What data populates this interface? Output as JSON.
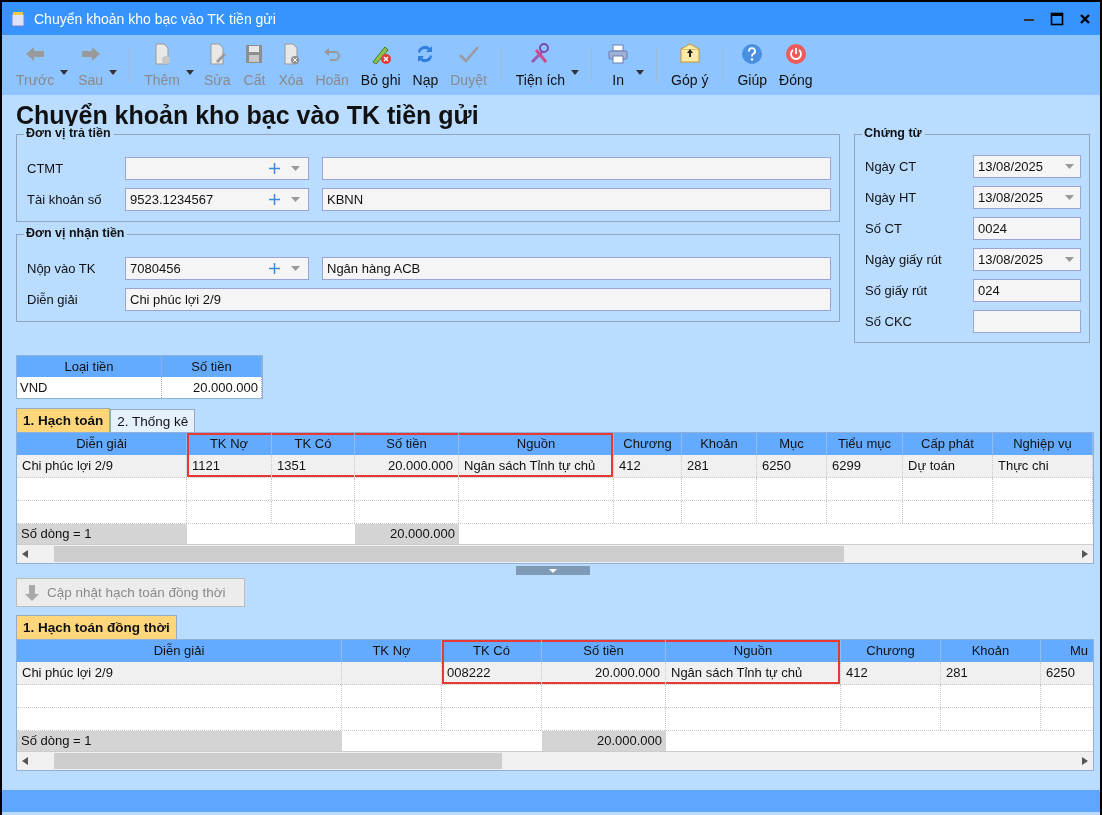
{
  "window": {
    "title": "Chuyển khoản kho bạc vào TK tiền gửi"
  },
  "toolbar": [
    {
      "items": [
        {
          "label": "Trước",
          "disabled": true,
          "kind": "split"
        },
        {
          "label": "Sau",
          "disabled": true,
          "kind": "split"
        }
      ]
    },
    {
      "items": [
        {
          "label": "Thêm",
          "disabled": true,
          "kind": "split"
        },
        {
          "label": "Sửa",
          "disabled": true,
          "kind": "plain"
        },
        {
          "label": "Cất",
          "disabled": true,
          "kind": "plain"
        },
        {
          "label": "Xóa",
          "disabled": true,
          "kind": "plain"
        },
        {
          "label": "Hoãn",
          "disabled": true,
          "kind": "plain"
        },
        {
          "label": "Bỏ ghi",
          "disabled": false,
          "kind": "plain"
        },
        {
          "label": "Nạp",
          "disabled": false,
          "kind": "plain"
        },
        {
          "label": "Duyệt",
          "disabled": true,
          "kind": "plain"
        }
      ]
    },
    {
      "items": [
        {
          "label": "Tiện ích",
          "disabled": false,
          "kind": "split"
        }
      ]
    },
    {
      "items": [
        {
          "label": "In",
          "disabled": false,
          "kind": "split"
        }
      ]
    },
    {
      "items": [
        {
          "label": "Góp ý",
          "disabled": false,
          "kind": "plain"
        }
      ]
    },
    {
      "items": [
        {
          "label": "Giúp",
          "disabled": false,
          "kind": "plain"
        },
        {
          "label": "Đóng",
          "disabled": false,
          "kind": "plain"
        }
      ]
    }
  ],
  "page_title": "Chuyển khoản kho bạc vào TK tiền gửi",
  "payer": {
    "title": "Đơn vị trả tiền",
    "fields": [
      {
        "kind": "combo",
        "label": "CTMT"
      },
      {
        "kind": "combo",
        "label": "Tài khoản số",
        "value": "9523.1234567",
        "detail": "KBNN"
      }
    ]
  },
  "payee": {
    "title": "Đơn vị nhận tiền",
    "fields": [
      {
        "kind": "combo",
        "label": "Nộp vào TK",
        "value": "7080456",
        "detail": "Ngân hàng ACB"
      },
      {
        "kind": "text",
        "label": "Diễn giải",
        "value": "Chi phúc lợi 2/9"
      }
    ]
  },
  "voucher": {
    "title": "Chứng từ",
    "fields": [
      {
        "kind": "date",
        "label": "Ngày CT",
        "value": "13/08/2025"
      },
      {
        "kind": "date",
        "label": "Ngày HT",
        "value": "13/08/2025"
      },
      {
        "kind": "text",
        "label": "Số CT",
        "value": "0024"
      },
      {
        "kind": "date",
        "label": "Ngày giấy rút",
        "value": "13/08/2025"
      },
      {
        "kind": "text",
        "label": "Số giấy rút",
        "value": "024"
      },
      {
        "kind": "text",
        "label": "Số CKC"
      }
    ]
  },
  "currency_table": {
    "columns": [
      "Loại tiền",
      "Số tiền"
    ],
    "rows": [
      [
        "VND",
        "20.000.000"
      ]
    ]
  },
  "grids": [
    {
      "tabs": [
        {
          "label": "1. Hạch toán",
          "selected": true
        },
        {
          "label": "2. Thống kê",
          "selected": false
        }
      ],
      "columns": [
        {
          "label": "Diễn giải",
          "kind": "text",
          "highlighted": false
        },
        {
          "label": "TK Nợ",
          "kind": "text",
          "highlighted": true
        },
        {
          "label": "TK Có",
          "kind": "text",
          "highlighted": true
        },
        {
          "label": "Số tiền",
          "kind": "amount",
          "highlighted": true
        },
        {
          "label": "Nguồn",
          "kind": "text",
          "highlighted": true
        },
        {
          "label": "Chương",
          "kind": "text",
          "highlighted": false
        },
        {
          "label": "Khoản",
          "kind": "text",
          "highlighted": false
        },
        {
          "label": "Mục",
          "kind": "text",
          "highlighted": false
        },
        {
          "label": "Tiểu mục",
          "kind": "text",
          "highlighted": false
        },
        {
          "label": "Cấp phát",
          "kind": "text",
          "highlighted": false
        },
        {
          "label": "Nghiệp vụ",
          "kind": "text",
          "highlighted": false
        }
      ],
      "rows": [
        {
          "selected": true,
          "cells": [
            "Chi phúc lợi 2/9",
            "1121",
            "1351",
            "20.000.000",
            "Ngân sách Tỉnh tự chủ",
            "412",
            "281",
            "6250",
            "6299",
            "Dự toán",
            "Thực chi"
          ]
        }
      ],
      "footer": {
        "count": "Số dòng = 1",
        "total": "20.000.000"
      }
    },
    {
      "tabs": [
        {
          "label": "1. Hạch toán đồng thời",
          "selected": true
        }
      ],
      "columns": [
        {
          "label": "Diễn giải",
          "kind": "text",
          "highlighted": false
        },
        {
          "label": "TK Nợ",
          "kind": "text",
          "highlighted": false
        },
        {
          "label": "TK Có",
          "kind": "text",
          "highlighted": true
        },
        {
          "label": "Số tiền",
          "kind": "amount",
          "highlighted": true
        },
        {
          "label": "Nguồn",
          "kind": "text",
          "highlighted": true
        },
        {
          "label": "Chương",
          "kind": "text",
          "highlighted": false
        },
        {
          "label": "Khoản",
          "kind": "text",
          "highlighted": false
        },
        {
          "label": "Mu",
          "kind": "text",
          "highlighted": false
        }
      ],
      "rows": [
        {
          "selected": true,
          "cells": [
            "Chi phúc lợi 2/9",
            "",
            "008222",
            "20.000.000",
            "Ngân sách Tỉnh tự chủ",
            "412",
            "281",
            "6250"
          ]
        }
      ],
      "footer": {
        "count": "Số dòng = 1",
        "total": "20.000.000"
      }
    }
  ],
  "update_button": {
    "label": "Cập nhật hạch toán đồng thời",
    "disabled": true
  }
}
